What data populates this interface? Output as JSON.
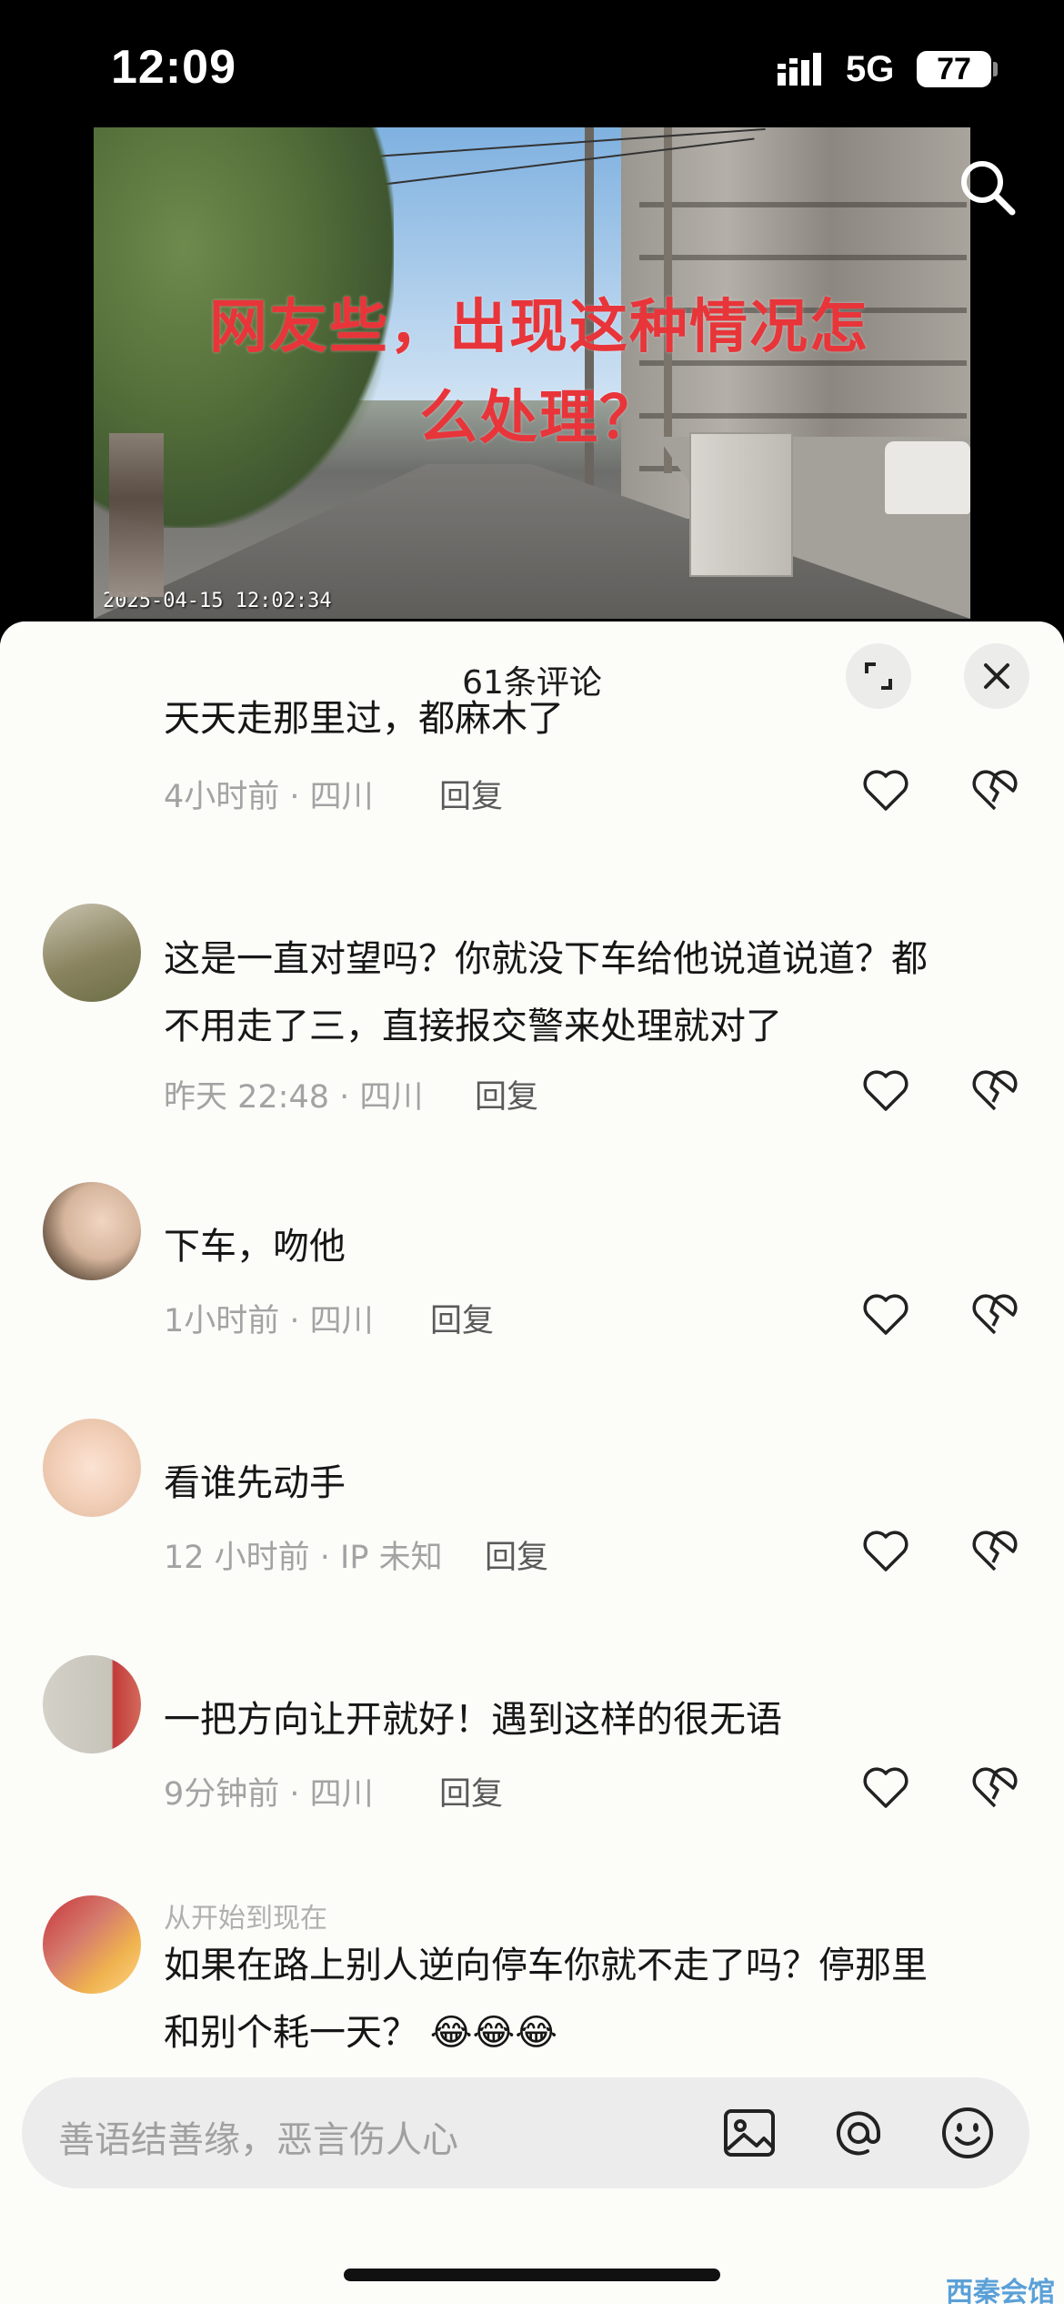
{
  "status_bar": {
    "time": "12:09",
    "network": "5G",
    "battery": "77"
  },
  "video": {
    "caption_line1": "网友些，出现这种情况怎",
    "caption_line2": "么处理？",
    "timestamp": "2025-04-15 12:02:34"
  },
  "sheet": {
    "comment_count": "61条评论"
  },
  "comments": [
    {
      "text": "天天走那里过，都麻木了",
      "time_location": "4小时前 · 四川",
      "reply": "回复"
    },
    {
      "text_line1": "这是一直对望吗？你就没下车给他说道说道？都",
      "text_line2": "不用走了三，直接报交警来处理就对了",
      "time_location": "昨天 22:48 · 四川",
      "reply": "回复"
    },
    {
      "text": "下车，吻他",
      "time_location": "1小时前 · 四川",
      "reply": "回复"
    },
    {
      "text": "看谁先动手",
      "time_location": "12 小时前 · IP 未知",
      "reply": "回复"
    },
    {
      "text": "一把方向让开就好！遇到这样的很无语",
      "time_location": "9分钟前 · 四川",
      "reply": "回复"
    },
    {
      "username": "从开始到现在",
      "text_line1": "如果在路上别人逆向停车你就不走了吗？停那里",
      "text_line2": "和别个耗一天？"
    }
  ],
  "input": {
    "placeholder": "善语结善缘，恶言伤人心"
  },
  "watermark": "西秦会馆",
  "icons": {
    "search": "search-icon",
    "expand": "expand-icon",
    "close": "close-icon",
    "like": "heart-icon",
    "dislike": "broken-heart-icon",
    "image": "image-icon",
    "at": "at-icon",
    "emoji": "emoji-icon"
  }
}
